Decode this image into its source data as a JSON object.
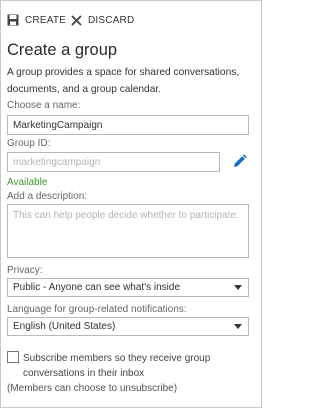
{
  "toolbar": {
    "create_label": "CREATE",
    "discard_label": "DISCARD",
    "create_icon": "save-icon",
    "discard_icon": "close-icon"
  },
  "form": {
    "title": "Create a group",
    "description": "A group provides a space for shared conversations, documents, and a group calendar.",
    "name": {
      "label": "Choose a name:",
      "value": "MarketingCampaign"
    },
    "group_id": {
      "label": "Group ID:",
      "placeholder": "marketingcampaign",
      "status": "Available",
      "edit_icon": "pencil-icon"
    },
    "group_description": {
      "label": "Add a description:",
      "placeholder": "This can help people decide whether to participate."
    },
    "privacy": {
      "label": "Privacy:",
      "selected": "Public - Anyone can see what's inside"
    },
    "language": {
      "label": "Language for group-related notifications:",
      "selected": "English (United States)"
    },
    "subscribe": {
      "label": "Subscribe members so they receive group conversations in their inbox",
      "checked": false
    },
    "unsubscribe_note": "(Members can choose to unsubscribe)"
  },
  "colors": {
    "accent": "#0f6fc6",
    "available": "#3a9a2e",
    "border": "#b8b8b8"
  }
}
